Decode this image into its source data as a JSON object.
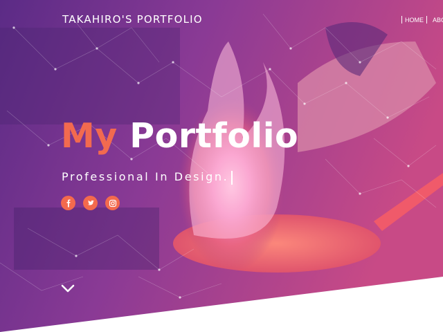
{
  "brand": {
    "name": "TAKAHIRO'S PORTFOLIO"
  },
  "nav": {
    "items": [
      {
        "label": "HOME"
      },
      {
        "label": "ABO"
      }
    ]
  },
  "hero": {
    "title_part1": "My",
    "title_part2": "Portfolio",
    "subtitle": "Professional In Design."
  },
  "social": [
    {
      "name": "facebook-icon",
      "glyph": "f"
    },
    {
      "name": "twitter-icon",
      "glyph": "t"
    },
    {
      "name": "instagram-icon",
      "glyph": "i"
    }
  ],
  "colors": {
    "accent": "#f26a4f",
    "overlay_left": "#5a2a8a",
    "overlay_right": "#d8477a"
  },
  "icons": {
    "scroll": "chevron-down-icon"
  }
}
